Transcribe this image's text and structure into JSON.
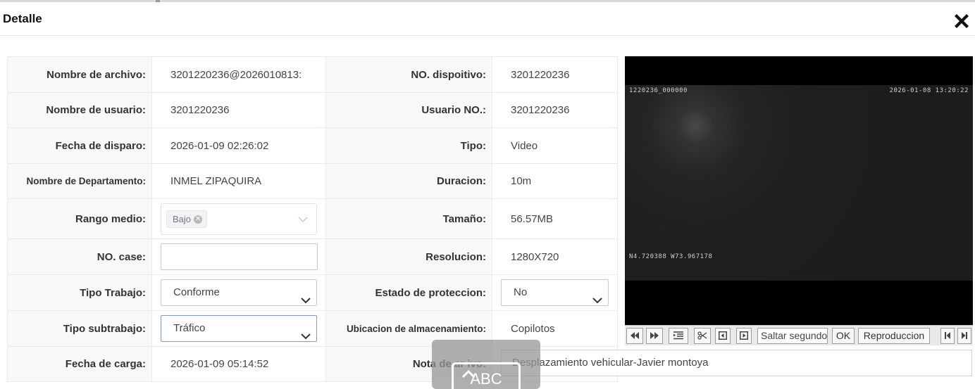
{
  "dialog": {
    "title": "Detalle",
    "close_icon": "close-x-icon"
  },
  "fields": {
    "file_name_label": "Nombre de archivo:",
    "file_name": "3201220236@2026010813:",
    "device_no_label": "NO. dispoitivo:",
    "device_no": "3201220236",
    "user_name_label": "Nombre de usuario:",
    "user_name": "3201220236",
    "user_no_label": "Usuario NO.:",
    "user_no": "3201220236",
    "trigger_date_label": "Fecha de disparo:",
    "trigger_date": "2026-01-09 02:26:02",
    "type_label": "Tipo:",
    "type": "Video",
    "department_label": "Nombre de Departamento:",
    "department": "INMEL ZIPAQUIRA",
    "duration_label": "Duracion:",
    "duration": "10m",
    "range_label": "Rango medio:",
    "range_tag": "Bajo",
    "size_label": "Tamaño:",
    "size": "56.57MB",
    "case_no_label": "NO. case:",
    "case_no": "",
    "resolution_label": "Resolucion:",
    "resolution": "1280X720",
    "work_type_label": "Tipo Trabajo:",
    "work_type": "Conforme",
    "protection_label": "Estado de proteccion:",
    "protection": "No",
    "subwork_type_label": "Tipo subtrabajo:",
    "subwork_type": "Tráfico",
    "storage_label": "Ubicacion de almacenamiento:",
    "storage": "Copilotos",
    "upload_date_label": "Fecha de carga:",
    "upload_date": "2026-01-09 05:14:52",
    "note_label": "Nota de ar   ivo:",
    "note": "Desplazamiento vehicular-Javier montoya"
  },
  "video": {
    "osd_top_left": "1220236_000000",
    "osd_top_right": "2026-01-08 13:20:22",
    "osd_coords": "N4.720388 W73.967178"
  },
  "player_controls": {
    "seek_placeholder": "Saltar segundos",
    "ok_label": "OK",
    "play_label": "Reproduccion"
  },
  "overlay": {
    "text": "ABC"
  }
}
